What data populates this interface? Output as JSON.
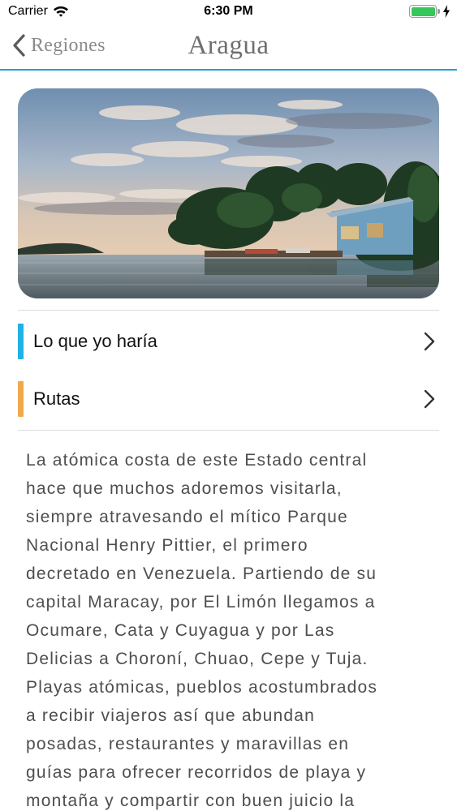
{
  "status_bar": {
    "carrier": "Carrier",
    "time": "6:30 PM",
    "battery_level": 1.0,
    "battery_color": "#35c759"
  },
  "nav": {
    "back_label": "Regiones",
    "title": "Aragua",
    "accent_color": "#1e9fd8"
  },
  "hero": {
    "icon": "photo-coastal-island-with-house"
  },
  "list": {
    "items": [
      {
        "label": "Lo que yo haría",
        "accent": "#1fb2e6",
        "icon": "chevron-right-icon"
      },
      {
        "label": "Rutas",
        "accent": "#f2a94a",
        "icon": "chevron-right-icon"
      }
    ]
  },
  "description": {
    "lines": [
      "La atómica costa de este Estado central",
      "hace que muchos adoremos visitarla,",
      "siempre atravesando el mítico Parque",
      "Nacional Henry Pittier, el primero",
      "decretado en Venezuela. Partiendo de su",
      "capital Maracay, por El Limón llegamos a",
      "Ocumare, Cata y Cuyagua y por Las",
      "Delicias a Choroní, Chuao, Cepe y Tuja.",
      "Playas atómicas, pueblos acostumbrados",
      "a recibir viajeros así que abundan",
      "posadas, restaurantes y maravillas en",
      "guías para ofrecer recorridos de playa y",
      "montaña y compartir con buen juicio la"
    ]
  }
}
